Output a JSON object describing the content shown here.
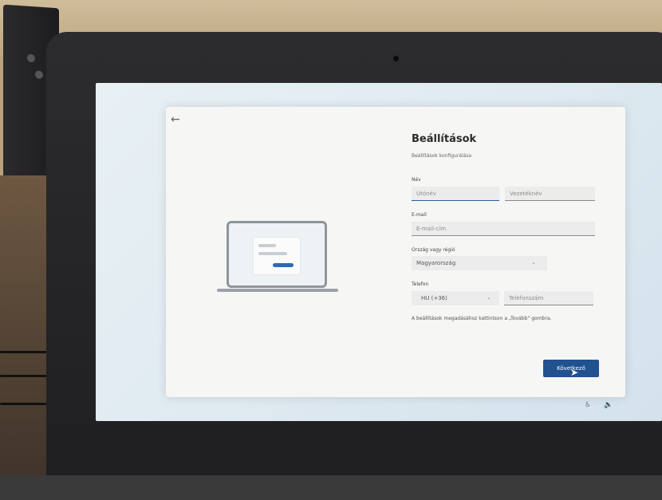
{
  "dialog": {
    "title": "Beállítások",
    "subtitle": "Beállítások konfigurálása",
    "name_label": "Név",
    "first_name_placeholder": "Utónév",
    "last_name_placeholder": "Vezetéknév",
    "email_label": "E-mail",
    "email_placeholder": "E-mail-cím",
    "country_label": "Ország vagy régió",
    "country_value": "Magyarország",
    "phone_label": "Telefon",
    "phone_code_value": "HU (+36)",
    "phone_placeholder": "Telefonszám",
    "hint": "A beállítások megadásához kattintson a „Tovább” gombra.",
    "next_label": "Következő"
  },
  "icons": {
    "back": "arrow-left-icon",
    "chevron": "chevron-down-icon",
    "accessibility": "accessibility-icon",
    "volume": "volume-icon"
  },
  "colors": {
    "accent": "#20528f",
    "dialog_bg": "#f6f6f5",
    "screen_bg": "#e3edf3"
  }
}
